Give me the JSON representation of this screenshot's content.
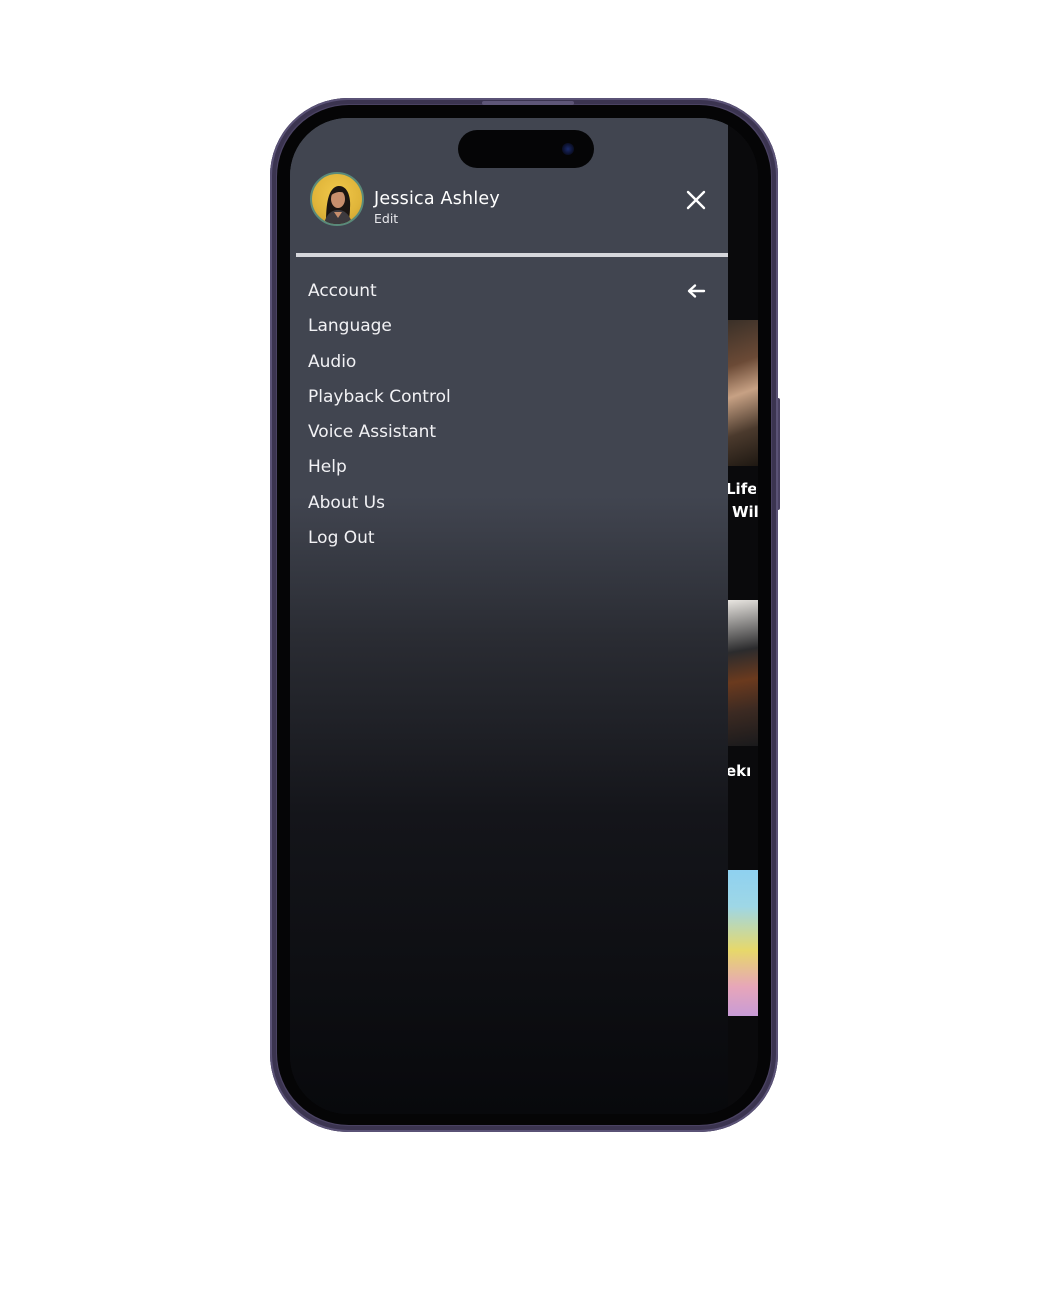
{
  "profile": {
    "name": "Jessica Ashley",
    "edit_label": "Edit"
  },
  "menu": {
    "items": [
      {
        "label": "Account"
      },
      {
        "label": "Language"
      },
      {
        "label": "Audio"
      },
      {
        "label": "Playback Control"
      },
      {
        "label": "Voice Assistant"
      },
      {
        "label": "Help"
      },
      {
        "label": "About Us"
      },
      {
        "label": "Log Out"
      }
    ]
  },
  "background": {
    "card_1_title_line_1": "Life",
    "card_1_title_line_2": "Wil",
    "card_2_title": "ekı"
  },
  "icons": {
    "close": "close-icon",
    "back": "arrow-left-icon",
    "avatar": "user-avatar"
  },
  "colors": {
    "drawer_bg": "#414550",
    "divider": "#d6d7dc",
    "text": "#f2f2f5",
    "phone_frame": "#4a4262"
  }
}
